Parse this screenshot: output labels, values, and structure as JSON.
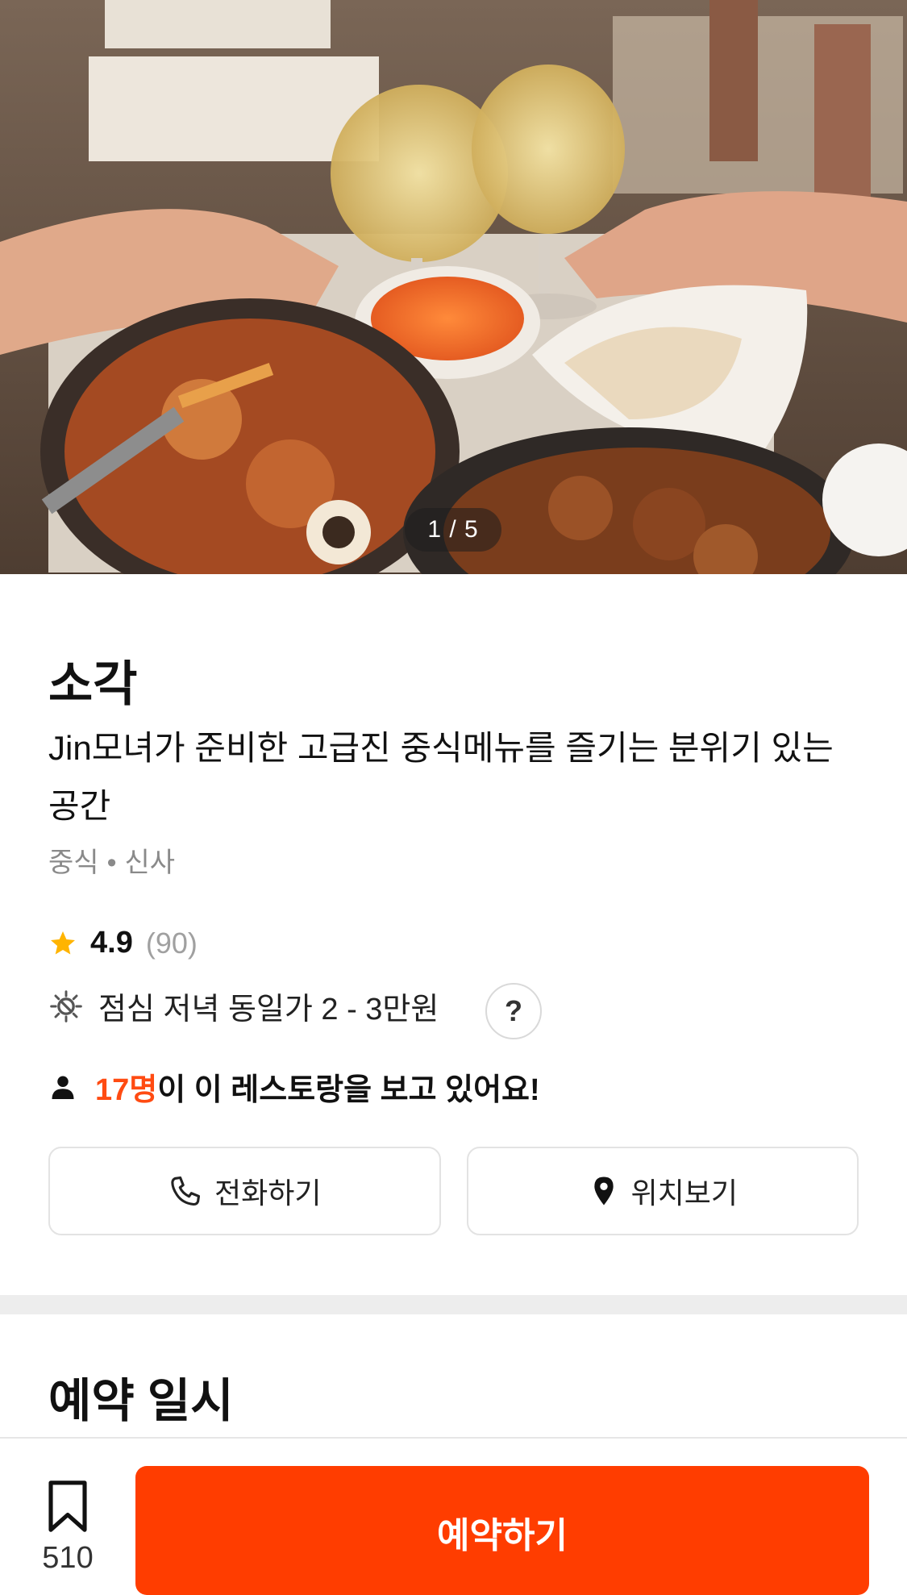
{
  "hero": {
    "photo_counter": "1 / 5"
  },
  "restaurant": {
    "name": "소각",
    "description": "Jin모녀가 준비한 고급진 중식메뉴를 즐기는 분위기 있는 공간",
    "category": "중식",
    "separator": "•",
    "location": "신사",
    "rating": "4.9",
    "review_count": "(90)",
    "price_text": "점심 저녁 동일가 2 - 3만원",
    "help_label": "?",
    "viewers_count": "17명",
    "viewers_text": "이 이 레스토랑을 보고 있어요!"
  },
  "actions": {
    "call_label": "전화하기",
    "location_label": "위치보기"
  },
  "reservation": {
    "section_title": "예약 일시"
  },
  "bottom_bar": {
    "bookmark_count": "510",
    "reserve_label": "예약하기"
  },
  "colors": {
    "accent": "#ff3d00",
    "viewer_highlight": "#ff4b12",
    "star": "#ffb400"
  },
  "icons": {
    "star": "star-icon",
    "price": "sun-moon-icon",
    "person": "person-icon",
    "phone": "phone-icon",
    "pin": "location-pin-icon",
    "bookmark": "bookmark-icon"
  }
}
